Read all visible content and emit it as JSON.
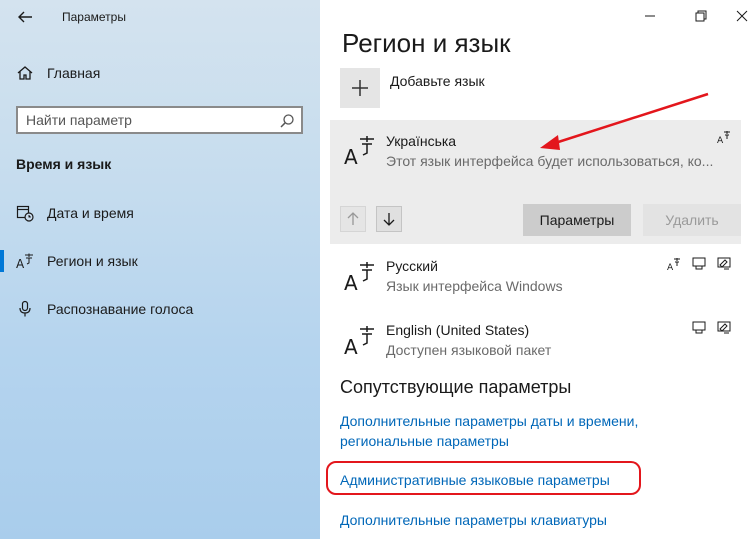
{
  "window": {
    "app_title": "Параметры"
  },
  "sidebar": {
    "home_label": "Главная",
    "search": {
      "placeholder": "Найти параметр"
    },
    "section_heading": "Время и язык",
    "items": [
      {
        "label": "Дата и время",
        "icon": "calendar-clock-icon"
      },
      {
        "label": "Регион и язык",
        "icon": "language-a-icon",
        "selected": true
      },
      {
        "label": "Распознавание голоса",
        "icon": "microphone-icon"
      }
    ]
  },
  "main": {
    "title": "Регион и язык",
    "add_language_label": "Добавьте язык",
    "languages": [
      {
        "name": "Українська",
        "description": "Этот язык интерфейса будет использоваться, ко...",
        "features": [
          "language-pack-icon"
        ]
      },
      {
        "name": "Русский",
        "description": "Язык интерфейса Windows",
        "features": [
          "language-pack-icon",
          "speech-icon",
          "handwriting-icon"
        ]
      },
      {
        "name": "English (United States)",
        "description": "Доступен языковой пакет",
        "features": [
          "speech-icon",
          "handwriting-icon"
        ]
      }
    ],
    "buttons": {
      "parameters": "Параметры",
      "remove": "Удалить"
    },
    "related": {
      "heading": "Сопутствующие параметры",
      "link_date_1": "Дополнительные параметры даты и времени,",
      "link_date_2": "региональные параметры",
      "link_admin": "Административные языковые параметры",
      "link_keyboard": "Дополнительные параметры клавиатуры"
    }
  },
  "colors": {
    "accent": "#0078d7",
    "link": "#0067b8",
    "annotation": "#e3161c"
  }
}
